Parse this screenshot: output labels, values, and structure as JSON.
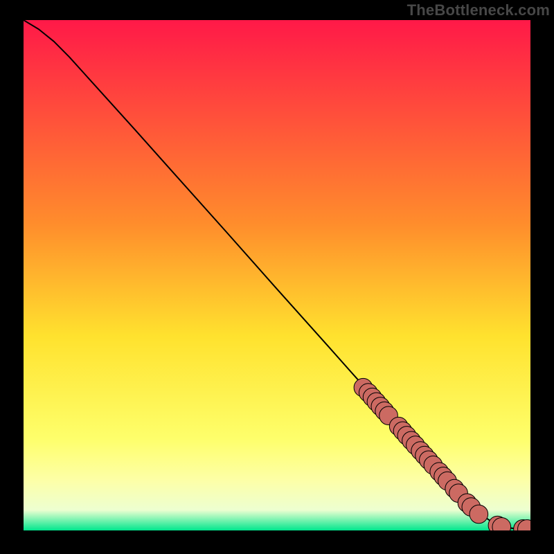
{
  "watermark": "TheBottleneck.com",
  "colors": {
    "gradient_top": "#ff1948",
    "gradient_mid1": "#ff8d2c",
    "gradient_mid2": "#ffe22e",
    "gradient_mid3": "#feff6b",
    "gradient_mid4": "#fdffa6",
    "gradient_mid5": "#edffd1",
    "gradient_bottom": "#00e68d",
    "curve": "#000000",
    "dot_fill": "#cc6a62",
    "dot_stroke": "#000000",
    "frame": "#000000"
  },
  "chart_data": {
    "type": "line",
    "title": "",
    "xlabel": "",
    "ylabel": "",
    "xlim": [
      0,
      100
    ],
    "ylim": [
      0,
      100
    ],
    "curve_points": [
      {
        "x": 0.0,
        "y": 100.0
      },
      {
        "x": 3.0,
        "y": 98.2
      },
      {
        "x": 6.0,
        "y": 95.8
      },
      {
        "x": 9.0,
        "y": 92.8
      },
      {
        "x": 12.0,
        "y": 89.5
      },
      {
        "x": 16.0,
        "y": 85.1
      },
      {
        "x": 22.0,
        "y": 78.5
      },
      {
        "x": 30.0,
        "y": 69.6
      },
      {
        "x": 40.0,
        "y": 58.5
      },
      {
        "x": 50.0,
        "y": 47.3
      },
      {
        "x": 60.0,
        "y": 36.2
      },
      {
        "x": 66.0,
        "y": 29.5
      },
      {
        "x": 72.0,
        "y": 22.8
      },
      {
        "x": 78.0,
        "y": 16.2
      },
      {
        "x": 83.0,
        "y": 10.6
      },
      {
        "x": 87.0,
        "y": 6.2
      },
      {
        "x": 90.0,
        "y": 3.3
      },
      {
        "x": 92.5,
        "y": 1.6
      },
      {
        "x": 95.0,
        "y": 0.6
      },
      {
        "x": 97.5,
        "y": 0.3
      },
      {
        "x": 100.0,
        "y": 0.3
      }
    ],
    "dots": [
      {
        "x": 67.0,
        "y": 28.0,
        "r": 1.0
      },
      {
        "x": 68.0,
        "y": 27.0,
        "r": 1.0
      },
      {
        "x": 68.8,
        "y": 26.1,
        "r": 1.0
      },
      {
        "x": 69.6,
        "y": 25.2,
        "r": 1.0
      },
      {
        "x": 70.4,
        "y": 24.3,
        "r": 1.0
      },
      {
        "x": 71.2,
        "y": 23.4,
        "r": 1.0
      },
      {
        "x": 72.0,
        "y": 22.5,
        "r": 1.0
      },
      {
        "x": 74.0,
        "y": 20.4,
        "r": 1.0
      },
      {
        "x": 74.8,
        "y": 19.5,
        "r": 1.0
      },
      {
        "x": 75.6,
        "y": 18.6,
        "r": 1.0
      },
      {
        "x": 76.5,
        "y": 17.6,
        "r": 1.0
      },
      {
        "x": 77.3,
        "y": 16.7,
        "r": 1.0
      },
      {
        "x": 78.3,
        "y": 15.6,
        "r": 1.0
      },
      {
        "x": 79.1,
        "y": 14.7,
        "r": 1.0
      },
      {
        "x": 79.9,
        "y": 13.8,
        "r": 1.0
      },
      {
        "x": 80.8,
        "y": 12.8,
        "r": 1.0
      },
      {
        "x": 82.0,
        "y": 11.5,
        "r": 1.0
      },
      {
        "x": 82.8,
        "y": 10.6,
        "r": 1.0
      },
      {
        "x": 83.6,
        "y": 9.7,
        "r": 1.0
      },
      {
        "x": 85.0,
        "y": 8.2,
        "r": 1.0
      },
      {
        "x": 85.8,
        "y": 7.3,
        "r": 1.0
      },
      {
        "x": 87.5,
        "y": 5.4,
        "r": 1.0
      },
      {
        "x": 88.3,
        "y": 4.6,
        "r": 1.0
      },
      {
        "x": 89.8,
        "y": 3.2,
        "r": 1.0
      },
      {
        "x": 93.5,
        "y": 1.0,
        "r": 1.0
      },
      {
        "x": 94.3,
        "y": 0.7,
        "r": 1.0
      },
      {
        "x": 98.5,
        "y": 0.3,
        "r": 1.0
      },
      {
        "x": 99.3,
        "y": 0.3,
        "r": 1.0
      }
    ]
  }
}
